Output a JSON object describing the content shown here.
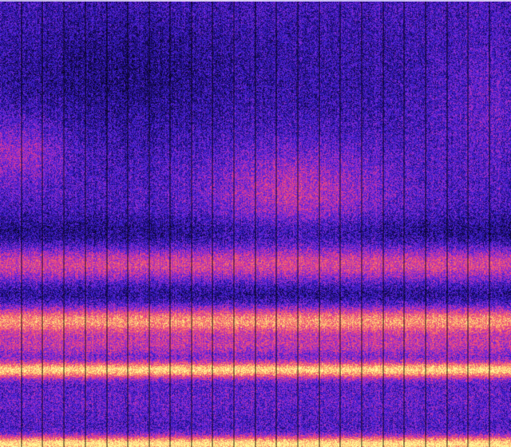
{
  "image": {
    "kind": "spectrogram",
    "colormap": [
      "#06041a",
      "#1a0a6b",
      "#3a1fd0",
      "#8a2bd8",
      "#e0388f",
      "#f56a6a",
      "#ffc773",
      "#fffb9a"
    ],
    "vertical_line_color": "#000000"
  }
}
